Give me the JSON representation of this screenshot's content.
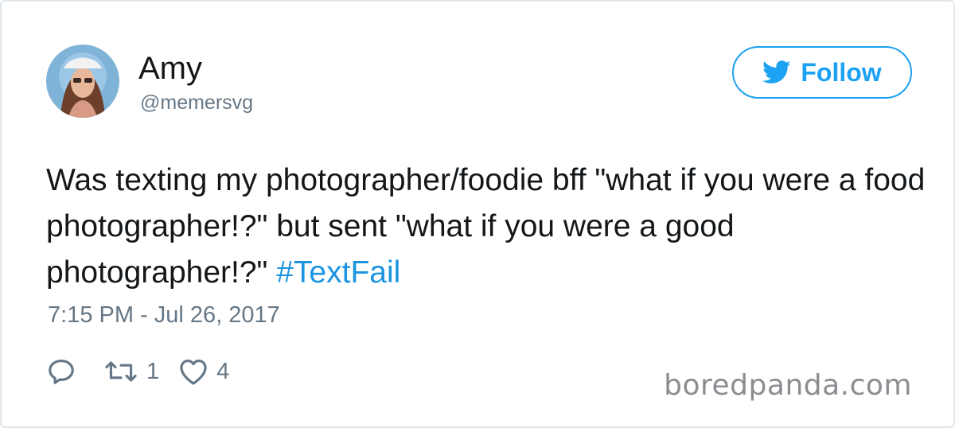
{
  "user": {
    "display_name": "Amy",
    "handle": "@memersvg",
    "avatar_icon": "avatar-photo"
  },
  "follow": {
    "label": "Follow",
    "icon": "twitter-bird-icon",
    "color": "#1da1f2"
  },
  "tweet": {
    "text": "Was texting my photographer/foodie bff \"what if you were a food photographer!?\" but sent \"what if you were a good photographer!?\" ",
    "hashtag": "#TextFail",
    "timestamp": "7:15 PM - Jul 26, 2017"
  },
  "actions": {
    "reply": {
      "icon": "reply-icon",
      "count": ""
    },
    "retweet": {
      "icon": "retweet-icon",
      "count": "1"
    },
    "like": {
      "icon": "heart-icon",
      "count": "4"
    }
  },
  "watermark": "boredpanda.com",
  "colors": {
    "text": "#14171a",
    "secondary": "#657786",
    "link": "#1b95e0",
    "border": "#e1e8ed"
  }
}
